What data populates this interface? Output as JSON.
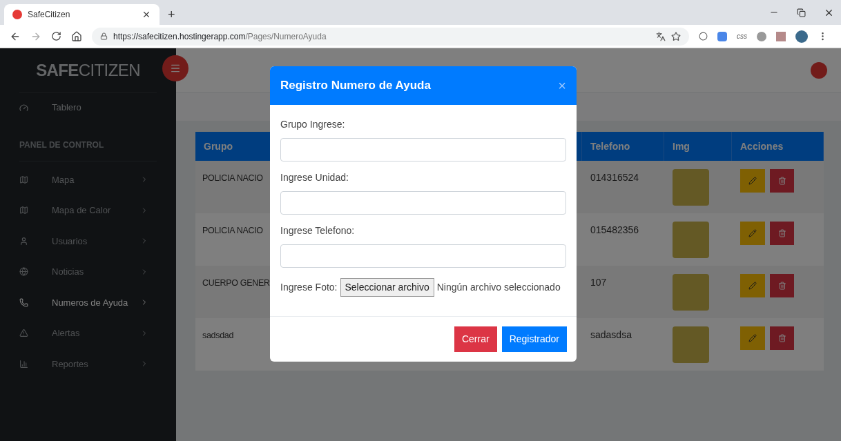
{
  "browser": {
    "tab_title": "SafeCitizen",
    "new_tab": "+",
    "url_host": "https://safecitizen.hostingerapp.com",
    "url_path": "/Pages/NumeroAyuda",
    "extension_label": "css"
  },
  "sidebar": {
    "brand": "**SAFE**CITIZEN",
    "top_item": {
      "label": "Tablero",
      "selected": false
    },
    "section": "PANEL DE CONTROL",
    "items": [
      {
        "label": "Mapa",
        "selected": false
      },
      {
        "label": "Mapa de Calor",
        "selected": false
      },
      {
        "label": "Usuarios",
        "selected": false
      },
      {
        "label": "Noticias",
        "selected": false
      },
      {
        "label": "Numeros de Ayuda",
        "selected": true
      },
      {
        "label": "Alertas",
        "selected": false
      },
      {
        "label": "Reportes",
        "selected": false
      }
    ]
  },
  "table": {
    "columns": [
      "Grupo",
      "",
      "Telefono",
      "Img",
      "Acciones"
    ],
    "rows": [
      {
        "grupo": "POLICIA NACIO",
        "telefono": "014316524"
      },
      {
        "grupo": "POLICIA NACIO",
        "telefono": "015482356"
      },
      {
        "grupo": "CUERPO GENER",
        "telefono": "107"
      },
      {
        "grupo": "sadsdad",
        "telefono": "sadasdsa"
      }
    ]
  },
  "modal": {
    "title": "Registro Numero de Ayuda",
    "close": "×",
    "fields": [
      {
        "label": "Grupo Ingrese:"
      },
      {
        "label": "Ingrese Unidad:"
      },
      {
        "label": "Ingrese Telefono:"
      }
    ],
    "file": {
      "label": "Ingrese Foto:",
      "button": "Seleccionar archivo",
      "status": "Ningún archivo seleccionado"
    },
    "buttons": [
      {
        "label": "Cerrar",
        "kind": "danger"
      },
      {
        "label": "Registrador",
        "kind": "primary"
      }
    ]
  }
}
